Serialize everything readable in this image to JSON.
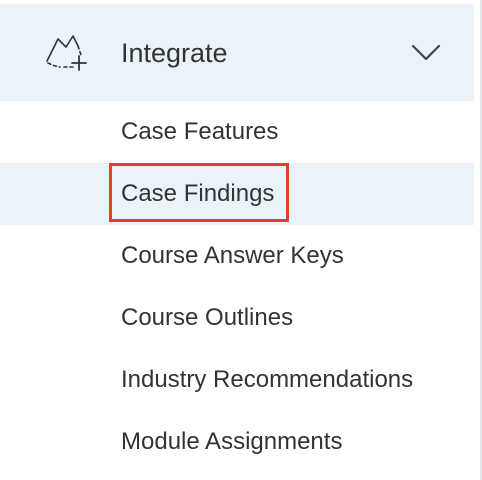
{
  "group": {
    "label": "Integrate",
    "icon": "integrate-plus-icon",
    "expand_icon": "chevron-down-icon"
  },
  "menu": {
    "items": [
      {
        "label": "Case Features"
      },
      {
        "label": "Case Findings",
        "active": true
      },
      {
        "label": "Course Answer Keys"
      },
      {
        "label": "Course Outlines"
      },
      {
        "label": "Industry Recommendations"
      },
      {
        "label": "Module Assignments"
      }
    ]
  },
  "colors": {
    "active_background": "#e9f3f9",
    "highlight_border": "#e0421f",
    "text": "#333333"
  }
}
